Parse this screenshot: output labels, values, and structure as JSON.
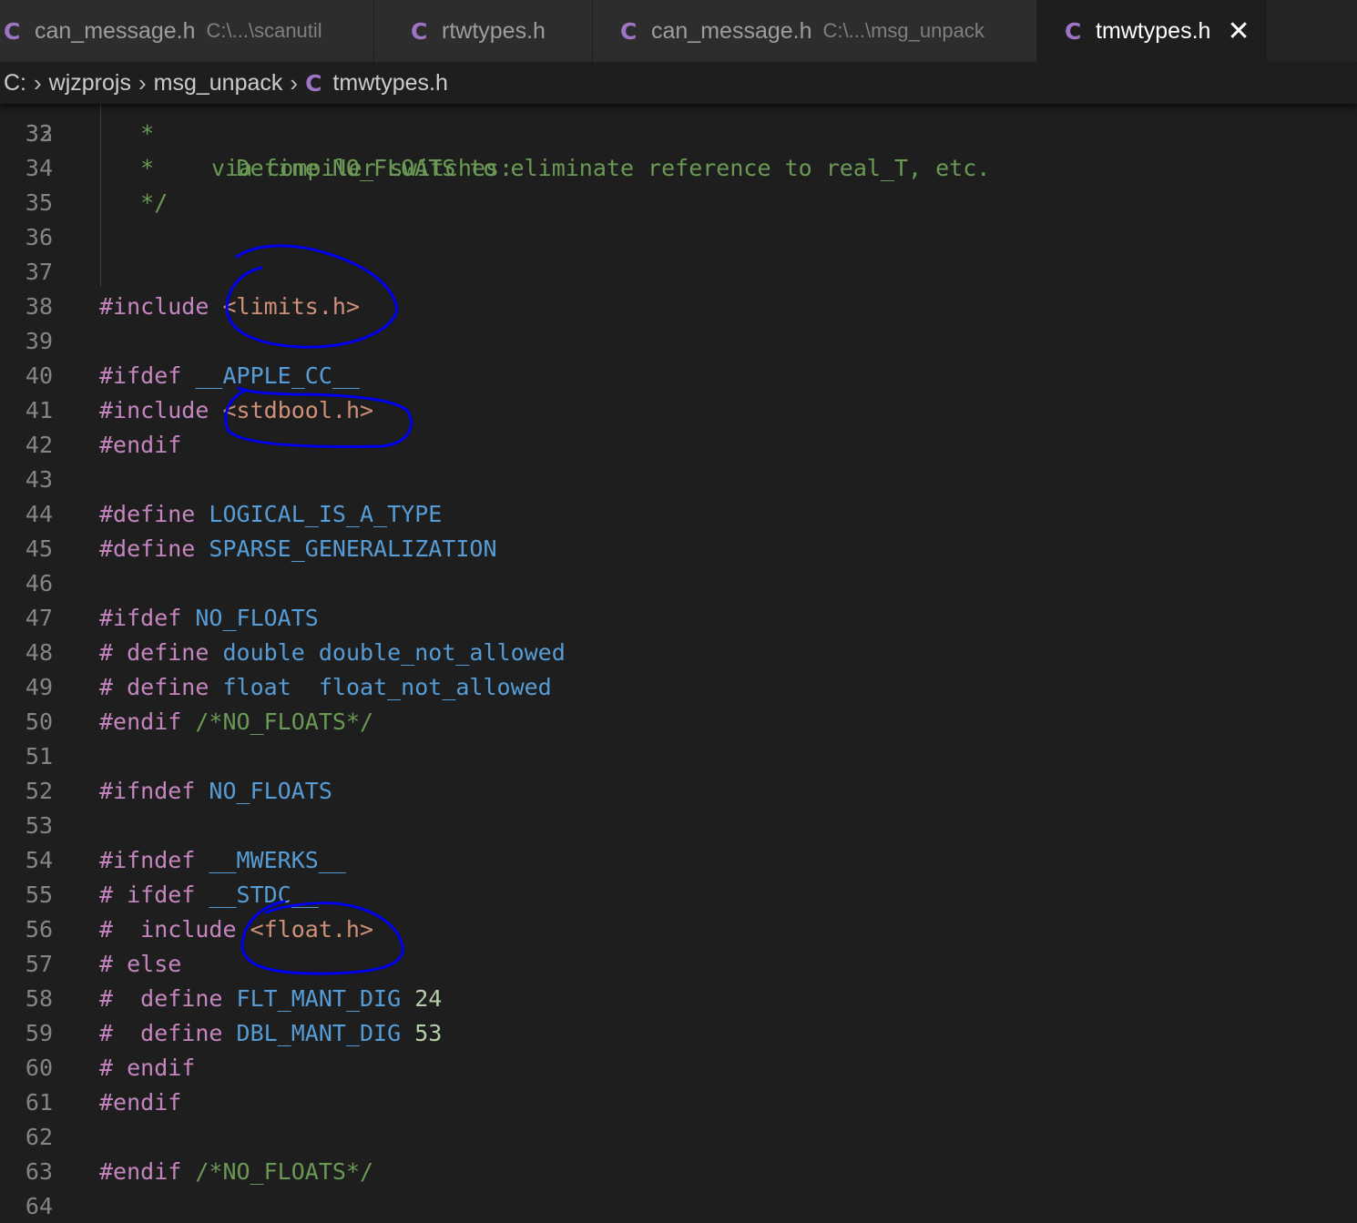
{
  "tabs": [
    {
      "name": "can_message.h",
      "path": "C:\\...\\scanutil",
      "active": false
    },
    {
      "name": "rtwtypes.h",
      "path": "",
      "active": false
    },
    {
      "name": "can_message.h",
      "path": "C:\\...\\msg_unpack",
      "active": false
    },
    {
      "name": "tmwtypes.h",
      "path": "",
      "active": true
    }
  ],
  "tab_icon_letter": "C",
  "close_glyph": "✕",
  "breadcrumb": {
    "drive": "C:",
    "folder1": "wjzprojs",
    "folder2": "msg_unpack",
    "file_icon": "C",
    "file": "tmwtypes.h",
    "separator": "›"
  },
  "partial_top_line": {
    "number": "32",
    "text": "via compiler switches:"
  },
  "lines": [
    {
      "n": "33",
      "tokens": [
        [
          "cm",
          "*"
        ]
      ],
      "indent": "   "
    },
    {
      "n": "34",
      "tokens": [
        [
          "cm",
          "*      Define NO_FLOATS to eliminate reference to real_T, etc."
        ]
      ],
      "indent": "   "
    },
    {
      "n": "35",
      "tokens": [
        [
          "cm",
          "*/"
        ]
      ],
      "indent": "   "
    },
    {
      "n": "36",
      "tokens": [],
      "indent": ""
    },
    {
      "n": "37",
      "tokens": [],
      "indent": ""
    },
    {
      "n": "38",
      "tokens": [
        [
          "pp",
          "#include"
        ],
        [
          "tx",
          " "
        ],
        [
          "str",
          "<limits.h>"
        ]
      ],
      "indent": ""
    },
    {
      "n": "39",
      "tokens": [],
      "indent": ""
    },
    {
      "n": "40",
      "tokens": [
        [
          "pp",
          "#ifdef"
        ],
        [
          "tx",
          " "
        ],
        [
          "id",
          "__APPLE_CC__"
        ]
      ],
      "indent": ""
    },
    {
      "n": "41",
      "tokens": [
        [
          "pp",
          "#include"
        ],
        [
          "tx",
          " "
        ],
        [
          "str",
          "<stdbool.h>"
        ]
      ],
      "indent": ""
    },
    {
      "n": "42",
      "tokens": [
        [
          "pp",
          "#endif"
        ]
      ],
      "indent": ""
    },
    {
      "n": "43",
      "tokens": [],
      "indent": ""
    },
    {
      "n": "44",
      "tokens": [
        [
          "pp",
          "#define"
        ],
        [
          "tx",
          " "
        ],
        [
          "id",
          "LOGICAL_IS_A_TYPE"
        ]
      ],
      "indent": ""
    },
    {
      "n": "45",
      "tokens": [
        [
          "pp",
          "#define"
        ],
        [
          "tx",
          " "
        ],
        [
          "id",
          "SPARSE_GENERALIZATION"
        ]
      ],
      "indent": ""
    },
    {
      "n": "46",
      "tokens": [],
      "indent": ""
    },
    {
      "n": "47",
      "tokens": [
        [
          "pp",
          "#ifdef"
        ],
        [
          "tx",
          " "
        ],
        [
          "id",
          "NO_FLOATS"
        ]
      ],
      "indent": ""
    },
    {
      "n": "48",
      "tokens": [
        [
          "pp",
          "# define"
        ],
        [
          "tx",
          " "
        ],
        [
          "id",
          "double"
        ],
        [
          "tx",
          " "
        ],
        [
          "id",
          "double_not_allowed"
        ]
      ],
      "indent": ""
    },
    {
      "n": "49",
      "tokens": [
        [
          "pp",
          "# define"
        ],
        [
          "tx",
          " "
        ],
        [
          "id",
          "float"
        ],
        [
          "tx",
          "  "
        ],
        [
          "id",
          "float_not_allowed"
        ]
      ],
      "indent": ""
    },
    {
      "n": "50",
      "tokens": [
        [
          "pp",
          "#endif"
        ],
        [
          "tx",
          " "
        ],
        [
          "cm",
          "/*NO_FLOATS*/"
        ]
      ],
      "indent": ""
    },
    {
      "n": "51",
      "tokens": [],
      "indent": ""
    },
    {
      "n": "52",
      "tokens": [
        [
          "pp",
          "#ifndef"
        ],
        [
          "tx",
          " "
        ],
        [
          "id",
          "NO_FLOATS"
        ]
      ],
      "indent": ""
    },
    {
      "n": "53",
      "tokens": [],
      "indent": ""
    },
    {
      "n": "54",
      "tokens": [
        [
          "pp",
          "#ifndef"
        ],
        [
          "tx",
          " "
        ],
        [
          "id",
          "__MWERKS__"
        ]
      ],
      "indent": ""
    },
    {
      "n": "55",
      "tokens": [
        [
          "pp",
          "# ifdef"
        ],
        [
          "tx",
          " "
        ],
        [
          "id",
          "__STDC__"
        ]
      ],
      "indent": ""
    },
    {
      "n": "56",
      "tokens": [
        [
          "pp",
          "#  include"
        ],
        [
          "tx",
          " "
        ],
        [
          "str",
          "<float.h>"
        ]
      ],
      "indent": ""
    },
    {
      "n": "57",
      "tokens": [
        [
          "pp",
          "# else"
        ]
      ],
      "indent": ""
    },
    {
      "n": "58",
      "tokens": [
        [
          "pp",
          "#  define"
        ],
        [
          "tx",
          " "
        ],
        [
          "id",
          "FLT_MANT_DIG"
        ],
        [
          "tx",
          " "
        ],
        [
          "num",
          "24"
        ]
      ],
      "indent": ""
    },
    {
      "n": "59",
      "tokens": [
        [
          "pp",
          "#  define"
        ],
        [
          "tx",
          " "
        ],
        [
          "id",
          "DBL_MANT_DIG"
        ],
        [
          "tx",
          " "
        ],
        [
          "num",
          "53"
        ]
      ],
      "indent": ""
    },
    {
      "n": "60",
      "tokens": [
        [
          "pp",
          "# endif"
        ]
      ],
      "indent": ""
    },
    {
      "n": "61",
      "tokens": [
        [
          "pp",
          "#endif"
        ]
      ],
      "indent": ""
    },
    {
      "n": "62",
      "tokens": [],
      "indent": ""
    },
    {
      "n": "63",
      "tokens": [
        [
          "pp",
          "#endif"
        ],
        [
          "tx",
          " "
        ],
        [
          "cm",
          "/*NO_FLOATS*/"
        ]
      ],
      "indent": ""
    },
    {
      "n": "64",
      "tokens": [],
      "indent": ""
    }
  ],
  "colors": {
    "background": "#1e1e1e",
    "preprocessor": "#c586c0",
    "identifier": "#569cd6",
    "string": "#ce9178",
    "comment": "#6a9955",
    "number": "#b5cea8",
    "annotation_ink": "#0000ee"
  }
}
